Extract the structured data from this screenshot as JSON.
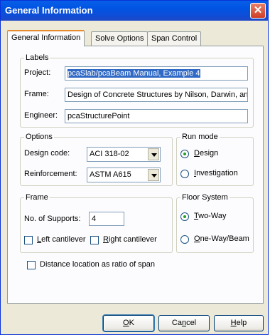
{
  "window": {
    "title": "General Information",
    "close_glyph": "✕"
  },
  "tabs": [
    {
      "label": "General Information",
      "active": true
    },
    {
      "label": "Solve Options",
      "active": false
    },
    {
      "label": "Span Control",
      "active": false
    }
  ],
  "labels_group": {
    "legend": "Labels",
    "project_label": "Project:",
    "project_value": "pcaSlab/pcaBeam Manual, Example 4",
    "frame_label": "Frame:",
    "frame_value": "Design of Concrete Structures by Nilson, Darwin, an",
    "engineer_label": "Engineer:",
    "engineer_value": "pcaStructurePoint"
  },
  "options_group": {
    "legend": "Options",
    "design_code_label": "Design code:",
    "design_code_value": "ACI 318-02",
    "reinforcement_label": "Reinforcement:",
    "reinforcement_value": "ASTM A615"
  },
  "run_mode_group": {
    "legend": "Run mode",
    "design_label_mn": "D",
    "design_label_rest": "esign",
    "investigation_label_mn": "I",
    "investigation_label_rest": "nvestigation",
    "selected": "Design"
  },
  "frame_group": {
    "legend": "Frame",
    "supports_label": "No. of Supports:",
    "supports_value": "4",
    "left_cantilever_mn": "L",
    "left_cantilever_rest": "eft cantilever",
    "right_cantilever_mn": "R",
    "right_cantilever_rest": "ight cantilever"
  },
  "floor_system_group": {
    "legend": "Floor System",
    "two_way_mn": "T",
    "two_way_rest": "wo-Way",
    "one_way_mn": "O",
    "one_way_rest": "ne-Way/Beam",
    "selected": "Two-Way"
  },
  "distance_ratio_label": "Distance location as ratio of span",
  "buttons": {
    "ok_mn": "O",
    "ok_rest": "K",
    "cancel_pre": "Ca",
    "cancel_mn": "n",
    "cancel_rest": "cel",
    "help_mn": "H",
    "help_rest": "elp"
  }
}
